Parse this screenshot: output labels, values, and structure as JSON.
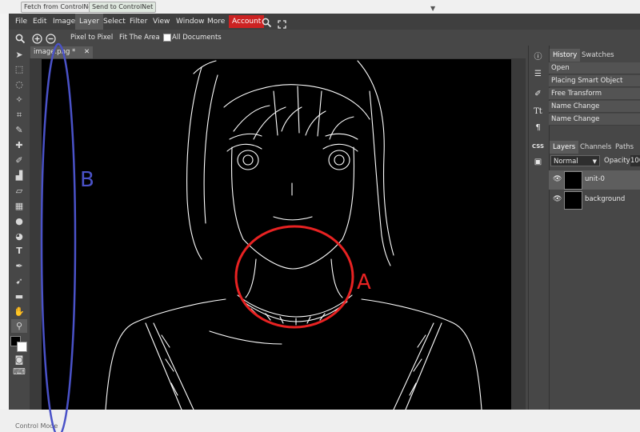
{
  "outer": {
    "fetch_button": "Fetch from ControlNet",
    "send_button": "Send to ControlNet",
    "footer_label": "Control Mode"
  },
  "menu": {
    "items": [
      "File",
      "Edit",
      "Image",
      "Layer",
      "Select",
      "Filter",
      "View",
      "Window",
      "More"
    ],
    "active_item": "Layer",
    "account": "Account"
  },
  "options": {
    "pixel_to_pixel": "Pixel to Pixel",
    "fit_area": "Fit The Area",
    "all_documents": "All Documents"
  },
  "document": {
    "tab_title": "image.png *"
  },
  "panels": {
    "history_tab": "History",
    "swatches_tab": "Swatches",
    "history": [
      "Open",
      "Placing Smart Object",
      "Free Transform",
      "Name Change",
      "Name Change"
    ],
    "layers_tab": "Layers",
    "channels_tab": "Channels",
    "paths_tab": "Paths",
    "blend_mode": "Normal",
    "opacity_label": "Opacity:",
    "opacity_value": "100",
    "layers": [
      "unit-0",
      "background"
    ]
  },
  "annotations": {
    "a_label": "A",
    "b_label": "B",
    "a_color": "#e82222",
    "b_color": "#4a52c8"
  },
  "colors": {
    "accent_account": "#cc2222"
  }
}
